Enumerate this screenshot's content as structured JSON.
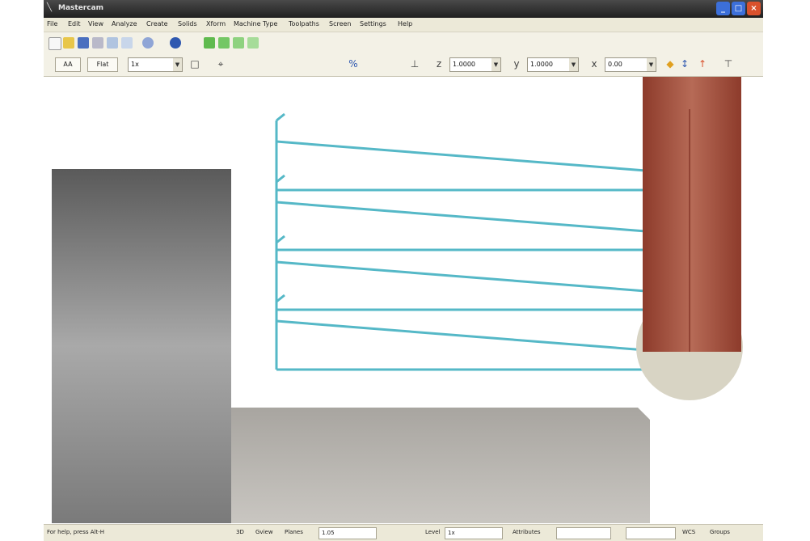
{
  "titlebar": {
    "title": "Mastercam",
    "min_icon": "minimize-icon",
    "max_icon": "maximize-icon",
    "close_icon": "close-icon"
  },
  "menu": [
    "File",
    "Edit",
    "View",
    "Analyze",
    "Create",
    "Solids",
    "Xform",
    "Machine Type",
    "Toolpaths",
    "Screen",
    "Settings",
    "Help"
  ],
  "toolbar1": {
    "icons": [
      "new-file-icon",
      "open-folder-icon",
      "save-icon",
      "print-icon",
      "cut-icon",
      "copy-icon",
      "view-orbit-icon",
      "shade-sphere-icon",
      "green-tool-icon"
    ]
  },
  "toolbar2": {
    "button_1": "AA",
    "button_2": "Flat",
    "level_select": "1x",
    "z_field": "1.0000",
    "y_field": "1.0000",
    "x_field": "0.00",
    "icons": [
      "analyze-icon",
      "point-icon",
      "line-icon",
      "tool-stem-icon",
      "tool-stem-icon-2",
      "arrow-icon"
    ]
  },
  "viewport": {
    "colors": {
      "toolpath": "#55b8c7",
      "tool": "#a0503e",
      "stock_dark": "#616161",
      "stock_light": "#b9b6b1",
      "holder": "#d8d4c4"
    }
  },
  "statusbar": {
    "text": "For help, press Alt-H",
    "label_3d": "3D",
    "label_gview": "Gview",
    "label_planes": "Planes",
    "z_value": "1.05",
    "level_label": "Level",
    "level_value": "1x",
    "attributes_label": "Attributes",
    "wcs_label": "WCS",
    "group_label": "Groups"
  }
}
